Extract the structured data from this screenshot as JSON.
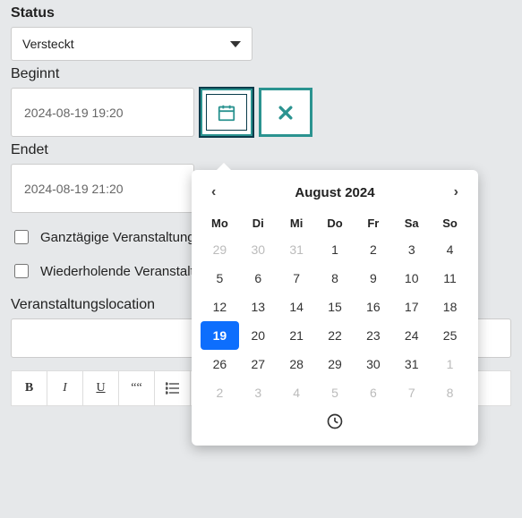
{
  "status": {
    "label": "Status",
    "value": "Versteckt"
  },
  "begin": {
    "label": "Beginnt",
    "value": "2024-08-19 19:20"
  },
  "end": {
    "label": "Endet",
    "value": "2024-08-19 21:20"
  },
  "allday_label": "Ganztägige Veranstaltung",
  "repeating_label": "Wiederholende Veranstaltung",
  "location_label": "Veranstaltungslocation",
  "toolbar": {
    "bold": "B",
    "italic": "I",
    "underline": "U",
    "quote": "““"
  },
  "calendar": {
    "title": "August 2024",
    "prev": "‹",
    "next": "›",
    "dow": [
      "Mo",
      "Di",
      "Mi",
      "Do",
      "Fr",
      "Sa",
      "So"
    ],
    "cells": [
      [
        "29",
        "out"
      ],
      [
        "30",
        "out"
      ],
      [
        "31",
        "out"
      ],
      [
        "1",
        ""
      ],
      [
        "2",
        ""
      ],
      [
        "3",
        ""
      ],
      [
        "4",
        ""
      ],
      [
        "5",
        ""
      ],
      [
        "6",
        ""
      ],
      [
        "7",
        ""
      ],
      [
        "8",
        ""
      ],
      [
        "9",
        ""
      ],
      [
        "10",
        ""
      ],
      [
        "11",
        ""
      ],
      [
        "12",
        ""
      ],
      [
        "13",
        ""
      ],
      [
        "14",
        ""
      ],
      [
        "15",
        ""
      ],
      [
        "16",
        ""
      ],
      [
        "17",
        ""
      ],
      [
        "18",
        ""
      ],
      [
        "19",
        "sel"
      ],
      [
        "20",
        ""
      ],
      [
        "21",
        ""
      ],
      [
        "22",
        ""
      ],
      [
        "23",
        ""
      ],
      [
        "24",
        ""
      ],
      [
        "25",
        ""
      ],
      [
        "26",
        ""
      ],
      [
        "27",
        ""
      ],
      [
        "28",
        ""
      ],
      [
        "29",
        ""
      ],
      [
        "30",
        ""
      ],
      [
        "31",
        ""
      ],
      [
        "1",
        "out"
      ],
      [
        "2",
        "out"
      ],
      [
        "3",
        "out"
      ],
      [
        "4",
        "out"
      ],
      [
        "5",
        "out"
      ],
      [
        "6",
        "out"
      ],
      [
        "7",
        "out"
      ],
      [
        "8",
        "out"
      ]
    ]
  }
}
